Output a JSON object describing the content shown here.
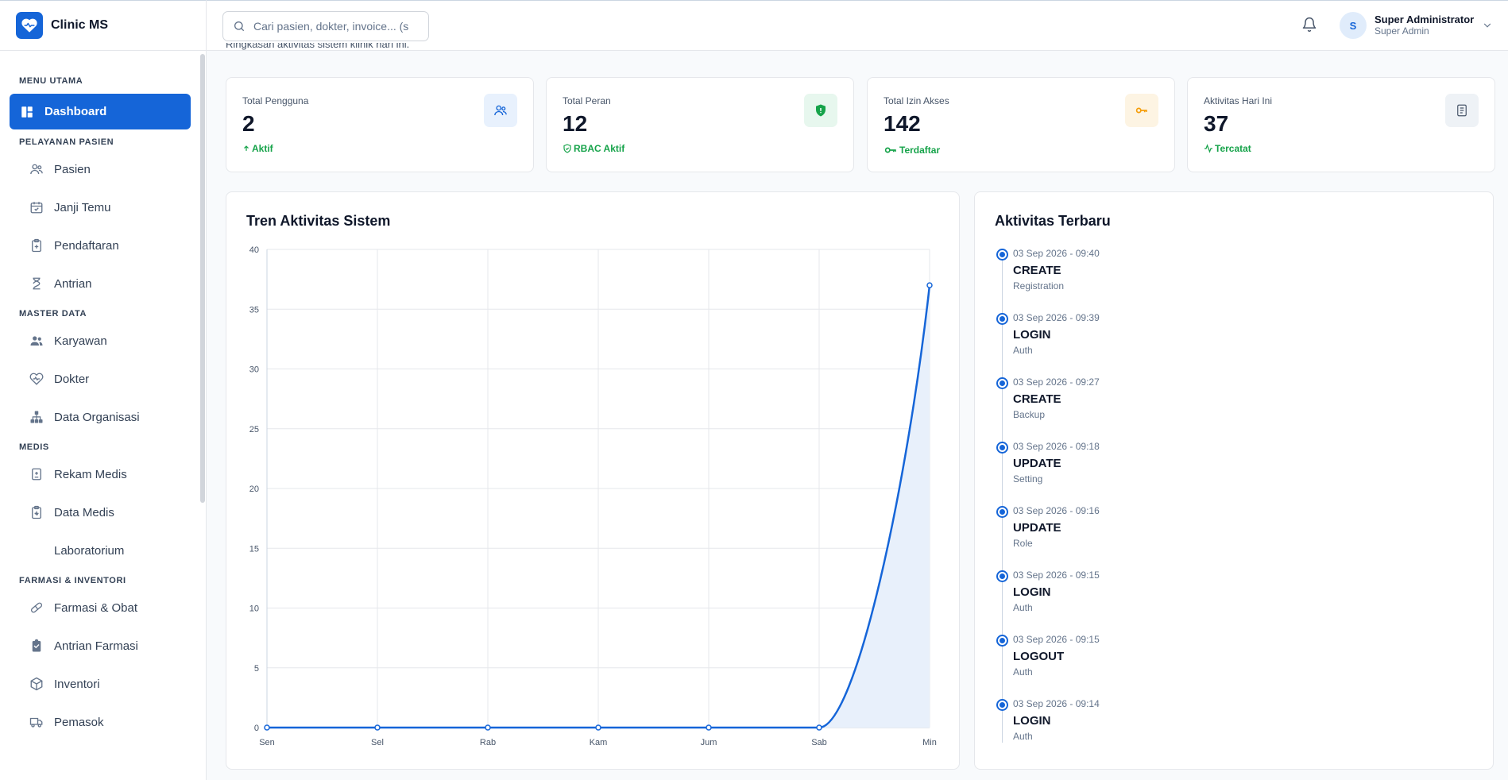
{
  "app": {
    "name": "Clinic MS",
    "logo_icon": "heart-pulse-icon",
    "brand_color": "#1565d8"
  },
  "header": {
    "search_placeholder": "Cari pasien, dokter, invoice... (s",
    "user": {
      "initial": "S",
      "name": "Super Administrator",
      "role": "Super Admin"
    }
  },
  "page": {
    "subtitle": "Ringkasan aktivitas sistem klinik hari ini."
  },
  "sidebar": {
    "sections": [
      {
        "label": "MENU UTAMA",
        "items": [
          {
            "label": "Dashboard",
            "icon": "dashboard-icon",
            "active": true
          }
        ]
      },
      {
        "label": "PELAYANAN PASIEN",
        "items": [
          {
            "label": "Pasien",
            "icon": "users-icon"
          },
          {
            "label": "Janji Temu",
            "icon": "calendar-check-icon"
          },
          {
            "label": "Pendaftaran",
            "icon": "clipboard-icon"
          },
          {
            "label": "Antrian",
            "icon": "hourglass-icon"
          }
        ]
      },
      {
        "label": "MASTER DATA",
        "items": [
          {
            "label": "Karyawan",
            "icon": "people-icon"
          },
          {
            "label": "Dokter",
            "icon": "heart-pulse-icon"
          },
          {
            "label": "Data Organisasi",
            "icon": "sitemap-icon"
          }
        ]
      },
      {
        "label": "MEDIS",
        "items": [
          {
            "label": "Rekam Medis",
            "icon": "file-medical-icon"
          },
          {
            "label": "Data Medis",
            "icon": "file-heart-icon"
          },
          {
            "label": "Laboratorium",
            "icon": ""
          }
        ]
      },
      {
        "label": "FARMASI & INVENTORI",
        "items": [
          {
            "label": "Farmasi & Obat",
            "icon": "pill-icon"
          },
          {
            "label": "Antrian Farmasi",
            "icon": "clipboard-list-icon"
          },
          {
            "label": "Inventori",
            "icon": "box-icon"
          },
          {
            "label": "Pemasok",
            "icon": "truck-icon"
          }
        ]
      }
    ]
  },
  "stats": [
    {
      "label": "Total Pengguna",
      "value": "2",
      "meta": "Aktif",
      "meta_icon": "arrow-up-icon",
      "icon": "users-icon",
      "icon_bg": "#e8f1fd",
      "icon_color": "#1565d8"
    },
    {
      "label": "Total Peran",
      "value": "12",
      "meta": "RBAC Aktif",
      "meta_icon": "shield-icon",
      "icon": "shield-check-icon",
      "icon_bg": "#e7f7ee",
      "icon_color": "#16a34a"
    },
    {
      "label": "Total Izin Akses",
      "value": "142",
      "meta": "Terdaftar",
      "meta_icon": "key-icon",
      "icon": "key-icon",
      "icon_bg": "#fdf4e3",
      "icon_color": "#f59e0b"
    },
    {
      "label": "Aktivitas Hari Ini",
      "value": "37",
      "meta": "Tercatat",
      "meta_icon": "activity-icon",
      "icon": "document-list-icon",
      "icon_bg": "#eef2f6",
      "icon_color": "#475569"
    }
  ],
  "trend": {
    "title": "Tren Aktivitas Sistem",
    "chart_data": {
      "type": "area",
      "categories": [
        "Sen",
        "Sel",
        "Rab",
        "Kam",
        "Jum",
        "Sab",
        "Min"
      ],
      "values": [
        0,
        0,
        0,
        0,
        0,
        0,
        37
      ],
      "ylim": [
        0,
        40
      ],
      "yticks": [
        0,
        5,
        10,
        15,
        20,
        25,
        30,
        35,
        40
      ],
      "grid": true,
      "line_color": "#1565d8",
      "fill_color": "#e8f0fb"
    }
  },
  "activity": {
    "title": "Aktivitas Terbaru",
    "items": [
      {
        "time": "03 Sep 2026 - 09:40",
        "action": "CREATE",
        "module": "Registration"
      },
      {
        "time": "03 Sep 2026 - 09:39",
        "action": "LOGIN",
        "module": "Auth"
      },
      {
        "time": "03 Sep 2026 - 09:27",
        "action": "CREATE",
        "module": "Backup"
      },
      {
        "time": "03 Sep 2026 - 09:18",
        "action": "UPDATE",
        "module": "Setting"
      },
      {
        "time": "03 Sep 2026 - 09:16",
        "action": "UPDATE",
        "module": "Role"
      },
      {
        "time": "03 Sep 2026 - 09:15",
        "action": "LOGIN",
        "module": "Auth"
      },
      {
        "time": "03 Sep 2026 - 09:15",
        "action": "LOGOUT",
        "module": "Auth"
      },
      {
        "time": "03 Sep 2026 - 09:14",
        "action": "LOGIN",
        "module": "Auth"
      }
    ]
  }
}
